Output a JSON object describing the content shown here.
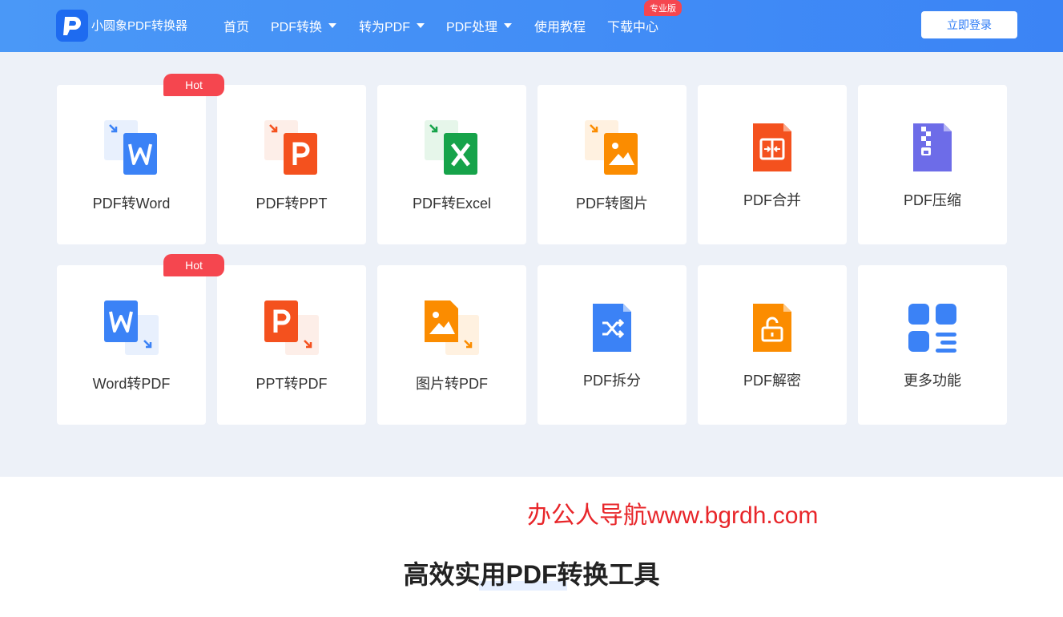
{
  "header": {
    "brand": "小圆象PDF转换器",
    "nav": [
      {
        "label": "首页",
        "dropdown": false
      },
      {
        "label": "PDF转换",
        "dropdown": true
      },
      {
        "label": "转为PDF",
        "dropdown": true
      },
      {
        "label": "PDF处理",
        "dropdown": true
      },
      {
        "label": "使用教程",
        "dropdown": false
      },
      {
        "label": "下载中心",
        "dropdown": false
      }
    ],
    "pro_badge": "专业版",
    "login_label": "立即登录"
  },
  "tools": {
    "row1": [
      {
        "label": "PDF转Word",
        "hot": "Hot",
        "icon": "pdf-to-word-icon",
        "color": "#3b82f6"
      },
      {
        "label": "PDF转PPT",
        "icon": "pdf-to-ppt-icon",
        "color": "#f4511e"
      },
      {
        "label": "PDF转Excel",
        "icon": "pdf-to-excel-icon",
        "color": "#16a34a"
      },
      {
        "label": "PDF转图片",
        "icon": "pdf-to-image-icon",
        "color": "#fb8c00"
      },
      {
        "label": "PDF合并",
        "icon": "pdf-merge-icon",
        "color": "#f4511e"
      },
      {
        "label": "PDF压缩",
        "icon": "pdf-compress-icon",
        "color": "#6d6ce8"
      }
    ],
    "row2": [
      {
        "label": "Word转PDF",
        "hot": "Hot",
        "icon": "word-to-pdf-icon",
        "color": "#3b82f6"
      },
      {
        "label": "PPT转PDF",
        "icon": "ppt-to-pdf-icon",
        "color": "#f4511e"
      },
      {
        "label": "图片转PDF",
        "icon": "image-to-pdf-icon",
        "color": "#fb8c00"
      },
      {
        "label": "PDF拆分",
        "icon": "pdf-split-icon",
        "color": "#3b82f6"
      },
      {
        "label": "PDF解密",
        "icon": "pdf-decrypt-icon",
        "color": "#fb8c00"
      },
      {
        "label": "更多功能",
        "icon": "more-features-icon",
        "color": "#3b82f6"
      }
    ]
  },
  "watermark": "办公人导航www.bgrdh.com",
  "section_title": "高效实用PDF转换工具"
}
